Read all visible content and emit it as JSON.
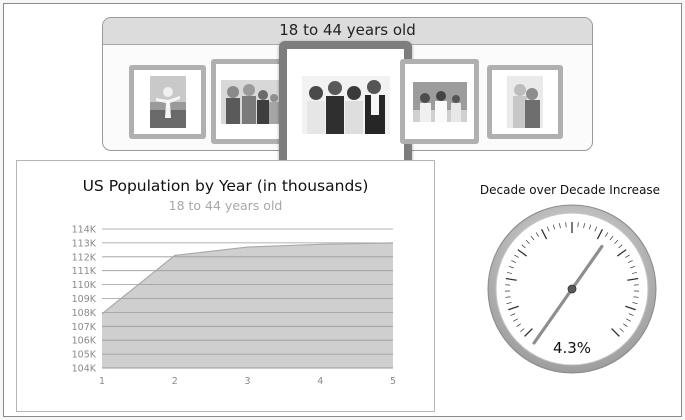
{
  "carousel": {
    "title": "18 to 44 years old",
    "thumbnails": [
      {
        "icon": "child-photo-icon"
      },
      {
        "icon": "family-photo-icon"
      },
      {
        "icon": "group-photo-icon",
        "selected": true
      },
      {
        "icon": "family-outdoor-photo-icon"
      },
      {
        "icon": "senior-couple-photo-icon"
      }
    ]
  },
  "chart_data": {
    "type": "area",
    "title": "US Population by Year (in thousands)",
    "subtitle": "18 to 44 years old",
    "x": [
      1,
      2,
      3,
      4,
      5
    ],
    "x_tick_labels": [
      "1",
      "2",
      "3",
      "4",
      "5"
    ],
    "y_tick_labels": [
      "114K",
      "113K",
      "112K",
      "111K",
      "110K",
      "109K",
      "108K",
      "107K",
      "106K",
      "105K",
      "104K"
    ],
    "ylim": [
      104,
      114
    ],
    "series": [
      {
        "values": [
          107.9,
          112.1,
          112.7,
          112.9,
          113.0
        ]
      }
    ],
    "grid": true,
    "fill_color": "#cfcfcf",
    "line_color": "#a9a9a9"
  },
  "gauge": {
    "title": "Decade over Decade Increase",
    "value_label": "4.3%",
    "needle_fraction": 0.63
  }
}
